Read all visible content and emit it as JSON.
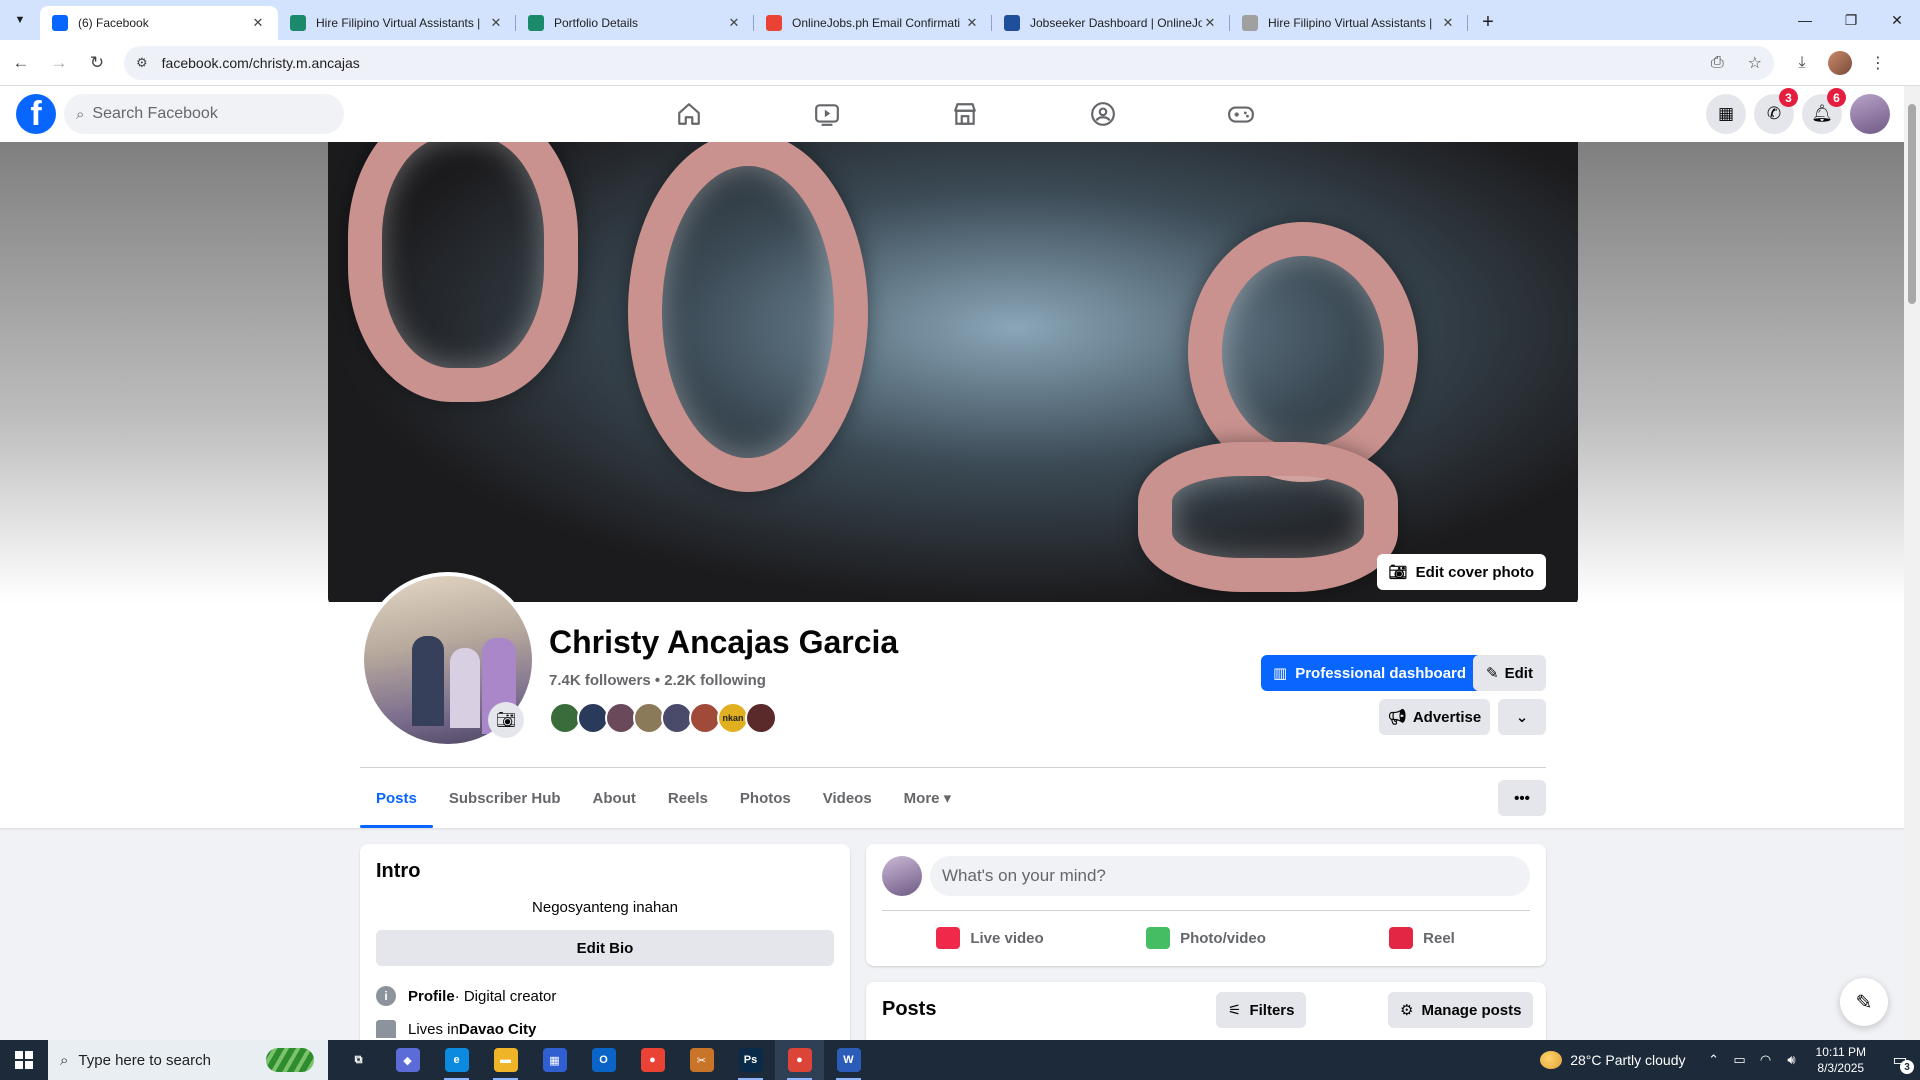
{
  "browser": {
    "tabs": [
      {
        "title": "(6) Facebook",
        "favicon": "facebook-icon",
        "color": "#0866ff",
        "active": true
      },
      {
        "title": "Hire Filipino Virtual Assistants |",
        "favicon": "onlinejobs-icon",
        "color": "#1a8a6a",
        "active": false
      },
      {
        "title": "Portfolio Details",
        "favicon": "onlinejobs-icon",
        "color": "#1a8a6a",
        "active": false
      },
      {
        "title": "OnlineJobs.ph Email Confirmati",
        "favicon": "gmail-icon",
        "color": "#ea4335",
        "active": false
      },
      {
        "title": "Jobseeker Dashboard | OnlineJo",
        "favicon": "globe-icon",
        "color": "#1f4e9a",
        "active": false
      },
      {
        "title": "Hire Filipino Virtual Assistants |",
        "favicon": "page-icon",
        "color": "#a0a0a0",
        "active": false
      }
    ],
    "url": "facebook.com/christy.m.ancajas"
  },
  "facebook": {
    "search_placeholder": "Search Facebook",
    "messenger_badge": "3",
    "notifications_badge": "6",
    "brand_color": "#0866ff"
  },
  "profile": {
    "name": "Christy Ancajas Garcia",
    "stats": "7.4K followers • 2.2K following",
    "edit_cover_label": "Edit cover photo",
    "professional_dashboard_label": "Professional dashboard",
    "edit_label": "Edit",
    "advertise_label": "Advertise",
    "friend_avatar_colors": [
      "#3a6b3a",
      "#2a3a5a",
      "#6a4a5a",
      "#8a7a5a",
      "#4a4a6a",
      "#a04a3a",
      "#e0b020",
      "#5a2a2a"
    ],
    "friend_avatar_text": "nkan",
    "tabs": [
      "Posts",
      "Subscriber Hub",
      "About",
      "Reels",
      "Photos",
      "Videos",
      "More ▾"
    ]
  },
  "intro": {
    "title": "Intro",
    "bio": "Negosyanteng inahan",
    "edit_bio_label": "Edit Bio",
    "profile_type_label": "Profile",
    "profile_type_value": " · Digital creator",
    "lives_in_prefix": "Lives in ",
    "lives_in_city": "Davao City"
  },
  "composer": {
    "placeholder": "What's on your mind?",
    "actions": [
      {
        "label": "Live video",
        "color": "#f02849"
      },
      {
        "label": "Photo/video",
        "color": "#45bd62"
      },
      {
        "label": "Reel",
        "color": "#e42645"
      }
    ]
  },
  "posts": {
    "title": "Posts",
    "filters_label": "Filters",
    "manage_label": "Manage posts"
  },
  "taskbar": {
    "search_placeholder": "Type here to search",
    "apps": [
      {
        "name": "task-view",
        "label": "⧉",
        "color": "#1c2a3a"
      },
      {
        "name": "copilot",
        "label": "◆",
        "color": "#5b6bd8"
      },
      {
        "name": "edge",
        "label": "e",
        "color": "#0c8adf"
      },
      {
        "name": "file-explorer",
        "label": "▬",
        "color": "#f0b429"
      },
      {
        "name": "store",
        "label": "▦",
        "color": "#2f5fd0"
      },
      {
        "name": "outlook",
        "label": "O",
        "color": "#0a64c8"
      },
      {
        "name": "chrome",
        "label": "●",
        "color": "#ea4335"
      },
      {
        "name": "snipping",
        "label": "✂",
        "color": "#c8752a"
      },
      {
        "name": "photoshop",
        "label": "Ps",
        "color": "#0a2a4a"
      },
      {
        "name": "chrome-profile",
        "label": "●",
        "color": "#db4437"
      },
      {
        "name": "word",
        "label": "W",
        "color": "#2b5cb8"
      }
    ],
    "weather": "28°C  Partly cloudy",
    "time": "10:11 PM",
    "date": "8/3/2025",
    "notifications_count": "3"
  }
}
